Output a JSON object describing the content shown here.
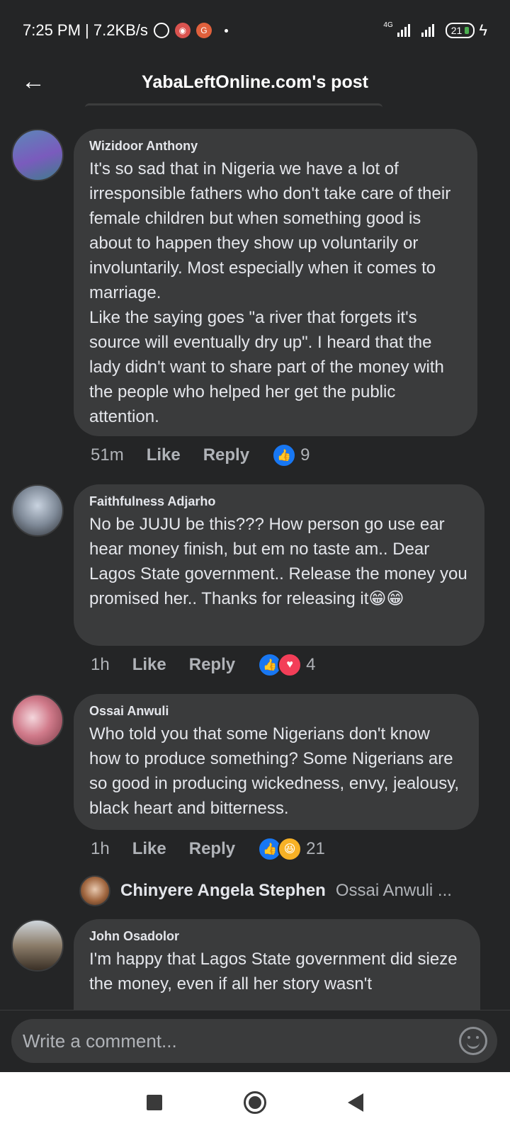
{
  "status_bar": {
    "time_speed": "7:25 PM | 7.2KB/s",
    "network_label": "4G",
    "battery": "21",
    "icons": [
      "alarm-icon",
      "app-notification-icon",
      "app-notification-icon",
      "signal-icon",
      "signal-icon",
      "charging-icon"
    ]
  },
  "header": {
    "title": "YabaLeftOnline.com's post",
    "back_icon": "back-arrow-icon"
  },
  "comments": [
    {
      "author": "Wizidoor Anthony",
      "text": "It's so sad that in Nigeria we have a lot of irresponsible fathers who don't take care of their female children but when something good is about to happen they show up voluntarily or involuntarily. Most especially when it comes to marriage.\nLike the saying goes \"a river that forgets it's source will eventually dry up\". I heard that the lady didn't want to share part of the money with the people who helped her get the public attention.",
      "time": "51m",
      "like_label": "Like",
      "reply_label": "Reply",
      "reaction_count": "9",
      "reactions": [
        "like"
      ]
    },
    {
      "author": "Faithfulness Adjarho",
      "text": "No be JUJU be this??? How person go use ear hear money finish, but em no taste am.. Dear Lagos State government.. Release the money you promised her.. Thanks for releasing it😁😁",
      "time": "1h",
      "like_label": "Like",
      "reply_label": "Reply",
      "reaction_count": "4",
      "reactions": [
        "like",
        "love"
      ]
    },
    {
      "author": "Ossai Anwuli",
      "text": "Who told you that some Nigerians don't know how to produce something? Some Nigerians are so good in producing wickedness, envy, jealousy,  black heart and bitterness.",
      "time": "1h",
      "like_label": "Like",
      "reply_label": "Reply",
      "reaction_count": "21",
      "reactions": [
        "like",
        "haha"
      ],
      "reply_preview": {
        "name": "Chinyere Angela Stephen",
        "text": "Ossai Anwuli ..."
      }
    },
    {
      "author": "John Osadolor",
      "text": "I'm happy that Lagos State government did sieze the money, even if all her story wasn't"
    }
  ],
  "composer": {
    "placeholder": "Write a comment...",
    "emoji_icon": "emoji-icon"
  },
  "nav": {
    "icons": [
      "recents-square-icon",
      "home-circle-icon",
      "back-triangle-icon"
    ]
  },
  "colors": {
    "background": "#242526",
    "bubble": "#3a3b3c",
    "like_blue": "#1877f2",
    "love_red": "#f33e58",
    "haha_yellow": "#f7b125"
  }
}
